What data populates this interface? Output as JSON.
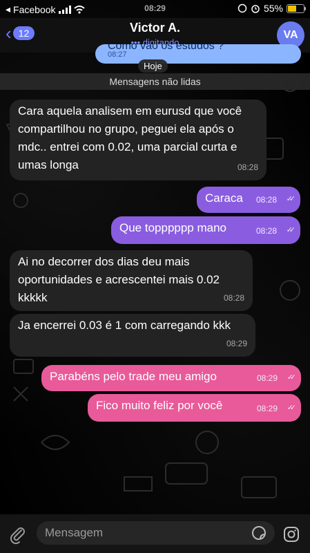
{
  "status_bar": {
    "back_app": "Facebook",
    "time": "08:29",
    "battery": "55%",
    "battery_level": 0.55
  },
  "header": {
    "back_count": "12",
    "name": "Victor A.",
    "status": "digitando",
    "avatar": "VA"
  },
  "partial_message": {
    "text": "Como vão os estudos ?",
    "time": "08:27"
  },
  "date_chip": "Hoje",
  "unread_divider": "Mensagens não lidas",
  "messages": [
    {
      "text": "Cara aquela analisem em eurusd que você compartilhou no grupo, peguei ela após o mdc.. entrei com 0.02, uma parcial curta e umas longa",
      "time": "08:28"
    },
    {
      "text": "Caraca",
      "time": "08:28"
    },
    {
      "text": "Que topppppp mano",
      "time": "08:28"
    },
    {
      "text": "Ai no decorrer dos dias deu mais oportunidades e acrescentei mais 0.02 kkkkk",
      "time": "08:28"
    },
    {
      "text": "Ja encerrei 0.03 é 1 com carregando kkk",
      "time": "08:29"
    },
    {
      "text": "Parabéns pelo trade meu amigo",
      "time": "08:29"
    },
    {
      "text": "Fico muito feliz por você",
      "time": "08:29"
    }
  ],
  "composer": {
    "placeholder": "Mensagem"
  },
  "icons": [
    "back-chevron-icon",
    "typing-dots-icon",
    "double-check-icon",
    "paperclip-icon",
    "sticker-icon",
    "instagram-icon",
    "wifi-icon",
    "signal-icon",
    "alarm-icon",
    "lock-rotation-icon"
  ]
}
